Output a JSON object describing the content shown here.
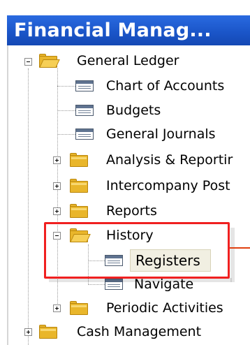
{
  "window": {
    "title": "Financial Manag..."
  },
  "tree": {
    "general_ledger": "General Ledger",
    "chart_of_accounts": "Chart of Accounts",
    "budgets": "Budgets",
    "general_journals": "General Journals",
    "analysis_reporting": "Analysis & Reportir",
    "intercompany_post": "Intercompany Post",
    "reports": "Reports",
    "history": "History",
    "registers": "Registers",
    "navigate": "Navigate",
    "periodic_activities": "Periodic Activities",
    "cash_management": "Cash Management"
  },
  "colors": {
    "title_bar": "#1b56c9",
    "highlight": "#f02020",
    "folder": "#e9b62b"
  },
  "selected_item": "Registers"
}
